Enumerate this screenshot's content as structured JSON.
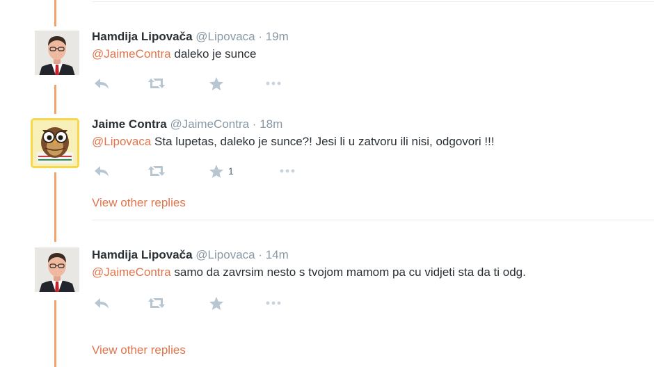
{
  "thread": {
    "tweets": [
      {
        "fullname": "Hamdija Lipovača",
        "handle": "@Lipovaca",
        "separator": " · ",
        "time": "19m",
        "mention": "@JaimeContra",
        "text": " daleko je sunce",
        "favorite_count": "",
        "avatar_icon": "man-in-suit-avatar"
      },
      {
        "fullname": "Jaime Contra",
        "handle": "@JaimeContra",
        "separator": " · ",
        "time": "18m",
        "mention": "@Lipovaca",
        "text": " Sta lupetas, daleko je sunce?! Jesi li u zatvoru ili nisi, odgovori !!!",
        "favorite_count": "1",
        "view_replies": "View other replies",
        "avatar_icon": "owl-avatar"
      },
      {
        "fullname": "Hamdija Lipovača",
        "handle": "@Lipovaca",
        "separator": " · ",
        "time": "14m",
        "mention": "@JaimeContra",
        "text": " samo da zavrsim nesto s tvojom mamom pa cu vidjeti sta da ti odg.",
        "favorite_count": "",
        "view_replies": "View other replies",
        "avatar_icon": "man-in-suit-avatar"
      }
    ]
  },
  "colors": {
    "link": "#e0754b",
    "thread_line": "#f2a36a",
    "action_icon": "#b7c6d1",
    "meta_text": "#8899a6"
  }
}
